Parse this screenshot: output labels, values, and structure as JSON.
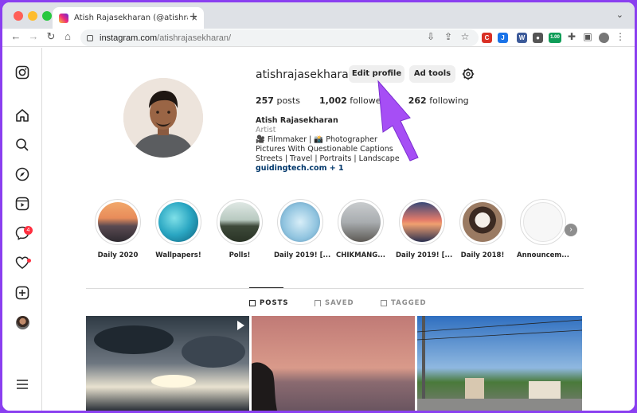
{
  "browser": {
    "tab_title": "Atish Rajasekharan (@atishraj",
    "new_tab": "+",
    "url_host": "instagram.com",
    "url_path": "/atishrajasekharan/",
    "extension_badge": "1.00"
  },
  "sidebar": {
    "message_badge": "4"
  },
  "profile": {
    "username": "atishrajasekharan",
    "edit_label": "Edit profile",
    "adtools_label": "Ad tools",
    "posts": "257",
    "posts_label": "posts",
    "followers": "1,002",
    "followers_label": "followers",
    "following": "262",
    "following_label": "following",
    "name": "Atish Rajasekharan",
    "category": "Artist",
    "bio_line1": "🎥 Filmmaker | 📸 Photographer",
    "bio_line2": "Pictures With Questionable Captions",
    "bio_line3": "Streets | Travel | Portraits | Landscape",
    "link": "guidingtech.com + 1"
  },
  "highlights": [
    {
      "label": "Daily 2020"
    },
    {
      "label": "Wallpapers!"
    },
    {
      "label": "Polls!"
    },
    {
      "label": "Daily 2019! [..."
    },
    {
      "label": "CHIKMANG..."
    },
    {
      "label": "Daily 2019! [..."
    },
    {
      "label": "Daily 2018!"
    },
    {
      "label": "Announcem..."
    }
  ],
  "profile_tabs": {
    "posts": "POSTS",
    "saved": "SAVED",
    "tagged": "TAGGED"
  },
  "colors": {
    "accent_arrow": "#a64ef5",
    "link": "#00376b",
    "background": "#8a3ff0"
  }
}
